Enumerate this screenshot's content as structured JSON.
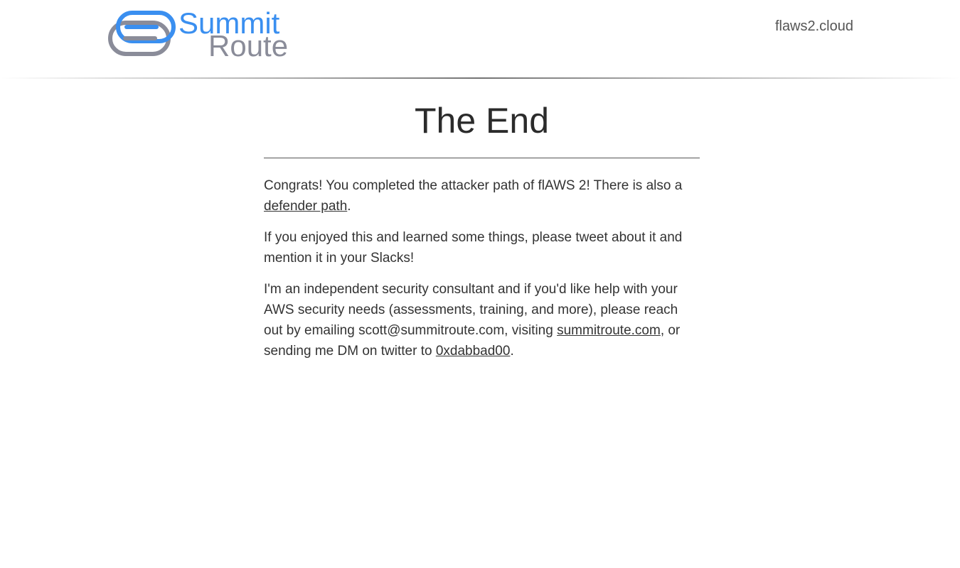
{
  "header": {
    "logo": {
      "icon": "summit-route-logo-icon",
      "line1": "Summit",
      "line2": "Route",
      "colors": {
        "blue": "#3a8ff0",
        "gray": "#8a8c99"
      }
    },
    "site_name": "flaws2.cloud"
  },
  "main": {
    "title": "The End",
    "paragraph1": {
      "text_before": "Congrats! You completed the attacker path of flAWS 2! There is also a ",
      "link_defender": "defender path",
      "text_after": "."
    },
    "paragraph2": {
      "text": "If you enjoyed this and learned some things, please tweet about it and mention it in your Slacks!"
    },
    "paragraph3": {
      "text_before": "I'm an independent security consultant and if you'd like help with your AWS security needs (assessments, training, and more), please reach out by emailing scott@summitroute.com, visiting ",
      "link_site": "summitroute.com",
      "text_middle": ", or sending me DM on twitter to ",
      "link_twitter": "0xdabbad00",
      "text_after": "."
    }
  }
}
